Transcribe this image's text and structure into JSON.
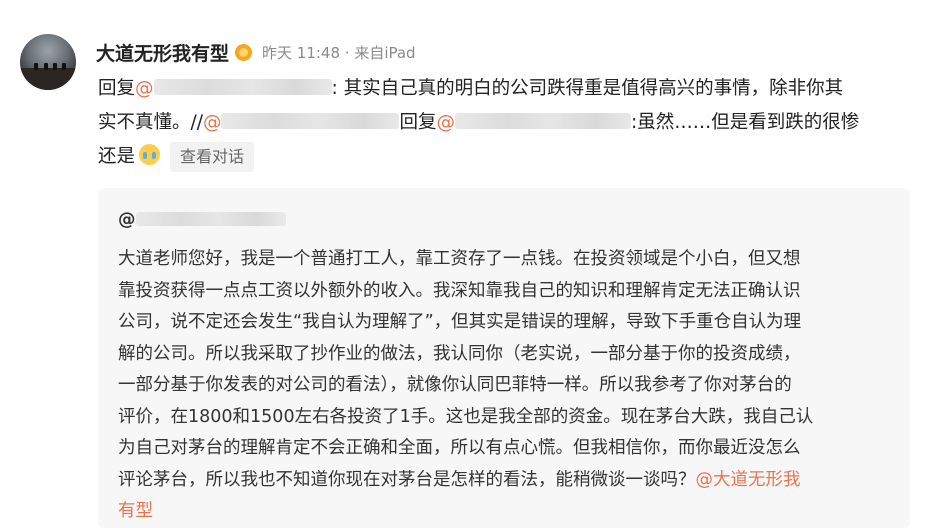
{
  "post": {
    "username": "大道无形我有型",
    "verified_badge_icon": "gold-verified-badge-icon",
    "meta": "昨天 11:48 · 来自iPad"
  },
  "reply": {
    "lines": [
      {
        "prefix": "回复",
        "mention": "@",
        "rest": ": 其实自己真的明白的公司跌得重是值得高兴的事情，除非你其"
      },
      {
        "start": "实不真懂。//",
        "mention1": "@",
        "mid": "回复",
        "mention2": "@",
        "rest": ":虽然……但是看到跌的很惨"
      },
      {
        "text": "还是",
        "emoji_icon": "crying-face-emoji-icon"
      }
    ],
    "view_conversation": "查看对话"
  },
  "quote": {
    "mention": "@",
    "lines": [
      "大道老师您好，我是一个普通打工人，靠工资存了一点钱。在投资领域是个小白，但又想",
      "靠投资获得一点点工资以外额外的收入。我深知靠我自己的知识和理解肯定无法正确认识",
      "公司，说不定还会发生“我自认为理解了”，但其实是错误的理解，导致下手重仓自认为理",
      "解的公司。所以我采取了抄作业的做法，我认同你（老实说，一部分基于你的投资成绩，",
      "一部分基于你发表的对公司的看法），就像你认同巴菲特一样。所以我参考了你对茅台的",
      "评价，在1800和1500左右各投资了1手。这也是我全部的资金。现在茅台大跌，我自己认",
      "为自己对茅台的理解肯定不会正确和全面，所以有点心慌。但我相信你，而你最近没怎么"
    ],
    "line8": "评论茅台，所以我也不知道你现在对茅台是怎样的看法，能稍微谈一谈吗？",
    "line8_mention": "@大道无形我",
    "line9_mention": "有型"
  },
  "colors": {
    "mention": "#eb7350",
    "meta": "#8a8a8a",
    "quote_bg": "#f7f7f7"
  }
}
